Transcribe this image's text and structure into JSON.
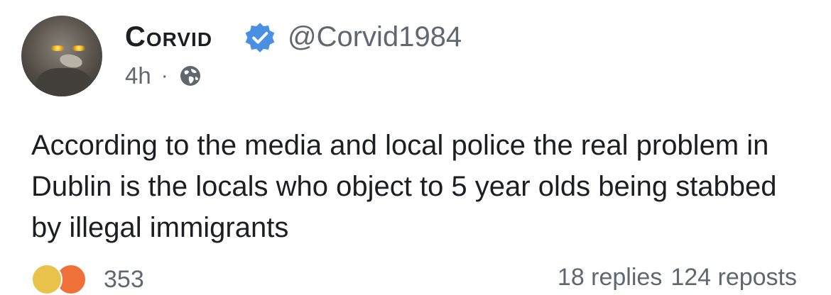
{
  "author": {
    "name": "Corvid",
    "handle": "@Corvid1984",
    "verified": true
  },
  "post": {
    "time": "4h",
    "separator": "·",
    "visibility_icon": "globe-icon",
    "text": "According to the media and local police the real problem in Dublin is the locals who object to 5 year olds being stabbed by illegal immigrants"
  },
  "engagement": {
    "reaction_icons": [
      "thumbs-up-icon",
      "angry-face-icon"
    ],
    "reaction_count": "353",
    "replies": "18 replies",
    "reposts": "124 reposts"
  },
  "colors": {
    "verified_blue": "#4a90e2",
    "meta_gray": "#606770"
  }
}
